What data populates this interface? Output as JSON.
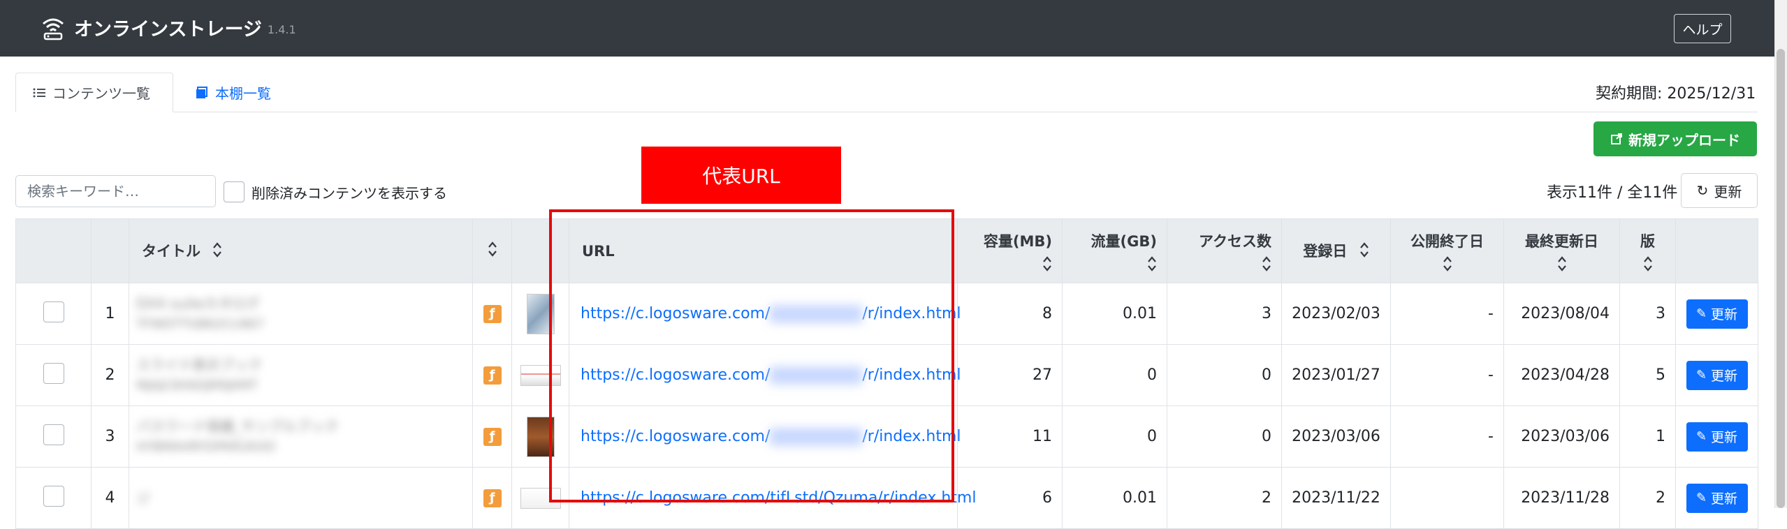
{
  "header": {
    "app_title": "オンラインストレージ",
    "version": "1.4.1",
    "help_label": "ヘルプ"
  },
  "tabs": [
    {
      "label": "コンテンツ一覧",
      "active": true
    },
    {
      "label": "本棚一覧",
      "active": false
    }
  ],
  "contract_period": "契約期間: 2025/12/31",
  "upload_button": "新規アップロード",
  "refresh_button": "更新",
  "count_text": "表示11件 / 全11件",
  "search": {
    "placeholder": "検索キーワード…",
    "value": ""
  },
  "show_deleted_label": "削除済みコンテンツを表示する",
  "annotation_label": "代表URL",
  "table": {
    "headers": {
      "title": "タイトル",
      "url": "URL",
      "size": "容量(MB)",
      "traffic": "流量(GB)",
      "access": "アクセス数",
      "registered": "登録日",
      "publish_end": "公開終了日",
      "updated": "最終更新日",
      "version": "版"
    },
    "edit_label": "更新",
    "rows": [
      {
        "no": "1",
        "title_line1": "DX4 suiteカタログ",
        "title_line2": "TFWDTTGB62CLN67",
        "url_prefix": "https://c.logosware.com/",
        "url_suffix": "/r/index.html",
        "size": "8",
        "traffic": "0.01",
        "access": "3",
        "registered": "2023/02/03",
        "publish_end": "-",
        "updated": "2023/08/04",
        "version": "3"
      },
      {
        "no": "2",
        "title_line1": "スライド表示ブック",
        "title_line2": "MJAJC8X6DJRRJKMT",
        "url_prefix": "https://c.logosware.com/",
        "url_suffix": "/r/index.html",
        "size": "27",
        "traffic": "0",
        "access": "0",
        "registered": "2023/01/27",
        "publish_end": "-",
        "updated": "2023/04/28",
        "version": "5"
      },
      {
        "no": "3",
        "title_line1": "パスワード保護_サンプルブック",
        "title_line2": "HYBMAHRYDPKR2KXD",
        "url_prefix": "https://c.logosware.com/",
        "url_suffix": "/r/index.html",
        "size": "11",
        "traffic": "0",
        "access": "0",
        "registered": "2023/03/06",
        "publish_end": "-",
        "updated": "2023/03/06",
        "version": "1"
      },
      {
        "no": "4",
        "title_line1": "ジ",
        "title_line2": "",
        "url_prefix": "https://c.logosware.com/tifLstd/Qzuma/r/index.html",
        "url_suffix": "",
        "size": "6",
        "traffic": "0.01",
        "access": "2",
        "registered": "2023/11/22",
        "publish_end": "",
        "updated": "2023/11/28",
        "version": "2"
      }
    ]
  }
}
